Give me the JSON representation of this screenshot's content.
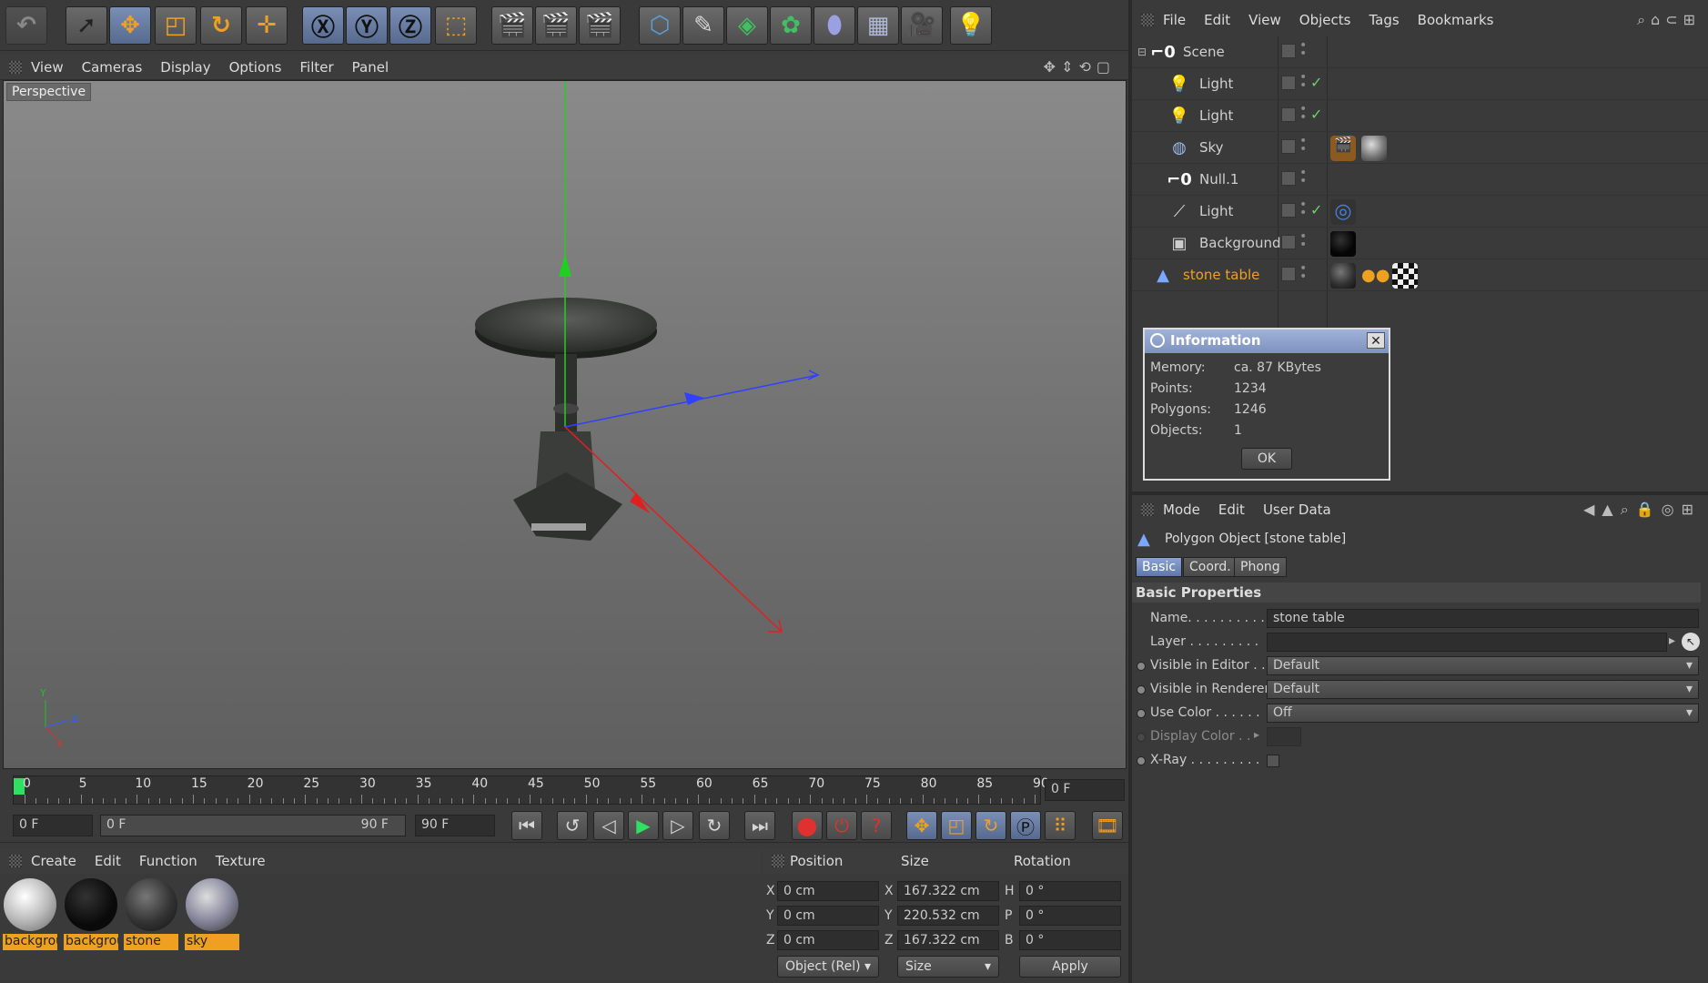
{
  "viewport_menu": [
    "View",
    "Cameras",
    "Display",
    "Options",
    "Filter",
    "Panel"
  ],
  "viewport_label": "Perspective",
  "timeline": {
    "ticks": [
      "0",
      "5",
      "10",
      "15",
      "20",
      "25",
      "30",
      "35",
      "40",
      "45",
      "50",
      "55",
      "60",
      "65",
      "70",
      "75",
      "80",
      "85",
      "90"
    ],
    "current_frame": "0 F",
    "start_field": "0 F",
    "range_start": "0 F",
    "range_end": "90 F",
    "end_field": "90 F"
  },
  "materials_menu": [
    "Create",
    "Edit",
    "Function",
    "Texture"
  ],
  "materials": [
    {
      "label": "backgrou",
      "color": "#dcdcdc"
    },
    {
      "label": "backgrou",
      "color": "#111111"
    },
    {
      "label": "stone",
      "color": "#3a3a3a"
    },
    {
      "label": "sky",
      "color": "#8a8aa0"
    }
  ],
  "coords": {
    "headers": [
      "Position",
      "Size",
      "Rotation"
    ],
    "rows": [
      {
        "axis": "X",
        "pos": "0 cm",
        "size_axis": "X",
        "size": "167.322 cm",
        "rot_axis": "H",
        "rot": "0 °"
      },
      {
        "axis": "Y",
        "pos": "0 cm",
        "size_axis": "Y",
        "size": "220.532 cm",
        "rot_axis": "P",
        "rot": "0 °"
      },
      {
        "axis": "Z",
        "pos": "0 cm",
        "size_axis": "Z",
        "size": "167.322 cm",
        "rot_axis": "B",
        "rot": "0 °"
      }
    ],
    "mode": "Object (Rel)",
    "size_mode": "Size",
    "apply": "Apply"
  },
  "object_menu": [
    "File",
    "Edit",
    "View",
    "Objects",
    "Tags",
    "Bookmarks"
  ],
  "objects": [
    {
      "name": "Scene",
      "icon": "null-icon",
      "indent": 0
    },
    {
      "name": "Light",
      "icon": "light-bulb-icon",
      "indent": 1
    },
    {
      "name": "Light",
      "icon": "light-bulb-icon",
      "indent": 1
    },
    {
      "name": "Sky",
      "icon": "sky-icon",
      "indent": 1
    },
    {
      "name": "Null.1",
      "icon": "null-icon",
      "indent": 1
    },
    {
      "name": "Light",
      "icon": "spot-light-icon",
      "indent": 1
    },
    {
      "name": "Background",
      "icon": "background-icon",
      "indent": 1
    },
    {
      "name": "stone table",
      "icon": "polygon-icon",
      "indent": 0
    }
  ],
  "info_dialog": {
    "title": "Information",
    "rows": [
      {
        "label": "Memory:",
        "value": "ca. 87 KBytes"
      },
      {
        "label": "Points:",
        "value": "1234"
      },
      {
        "label": "Polygons:",
        "value": "1246"
      },
      {
        "label": "Objects:",
        "value": "1"
      }
    ],
    "ok": "OK"
  },
  "attr_menu": [
    "Mode",
    "Edit",
    "User Data"
  ],
  "attributes": {
    "object_title": "Polygon Object [stone table]",
    "tabs": [
      "Basic",
      "Coord.",
      "Phong"
    ],
    "section": "Basic Properties",
    "props": [
      {
        "label": "Name. . . . . . . . . .",
        "value": "stone table"
      },
      {
        "label": "Layer . . . . . . . . .",
        "value": ""
      },
      {
        "label": "Visible in Editor . .",
        "value": "Default"
      },
      {
        "label": "Visible in Renderer",
        "value": "Default"
      },
      {
        "label": "Use Color . . . . . .",
        "value": "Off"
      },
      {
        "label": "Display Color . .",
        "value": ""
      },
      {
        "label": "X-Ray . . . . . . . . .",
        "value": ""
      }
    ]
  },
  "colors": {
    "accent": "#f0a020",
    "selection": "#6f86b8"
  }
}
